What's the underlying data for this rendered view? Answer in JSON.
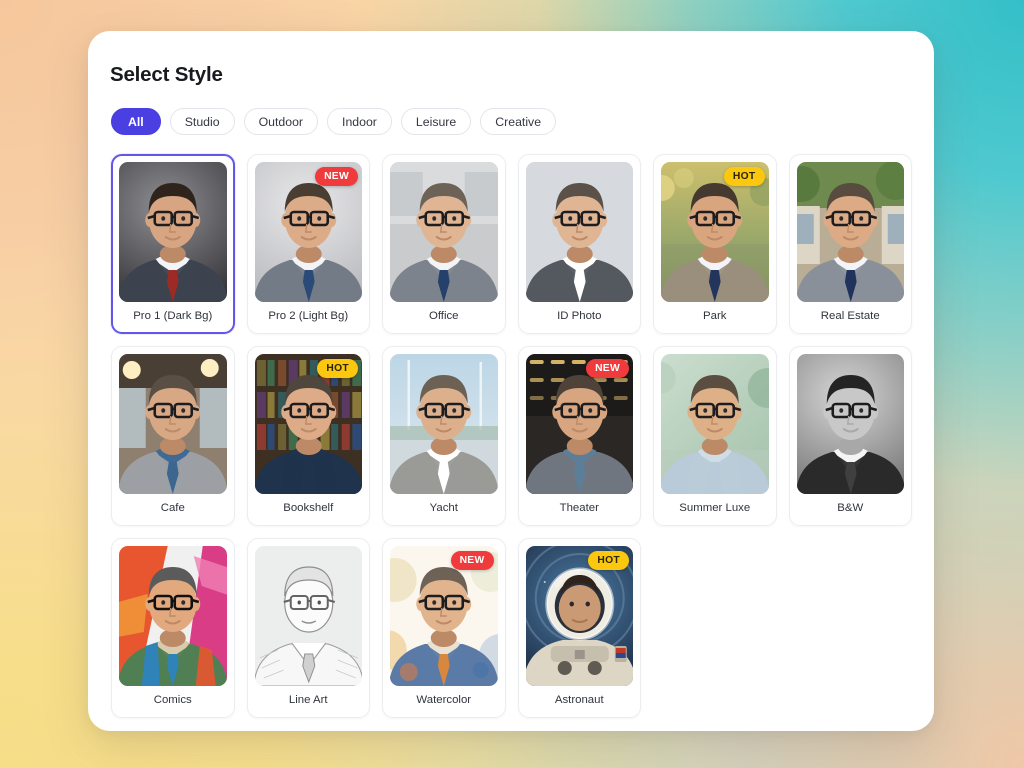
{
  "header": {
    "title": "Select Style"
  },
  "filters": {
    "items": [
      {
        "label": "All",
        "active": true
      },
      {
        "label": "Studio",
        "active": false
      },
      {
        "label": "Outdoor",
        "active": false
      },
      {
        "label": "Indoor",
        "active": false
      },
      {
        "label": "Leisure",
        "active": false
      },
      {
        "label": "Creative",
        "active": false
      }
    ]
  },
  "colors": {
    "accent": "#4a3fe0",
    "selected_border": "#6257e8",
    "badge_new": "#ef3b3b",
    "badge_hot": "#fbc80f",
    "panel_bg": "#ffffff"
  },
  "styles": {
    "cards": [
      {
        "label": "Pro 1 (Dark Bg)",
        "badge": "",
        "selected": true,
        "art": "pro-dark"
      },
      {
        "label": "Pro 2 (Light Bg)",
        "badge": "NEW",
        "selected": false,
        "art": "pro-light"
      },
      {
        "label": "Office",
        "badge": "",
        "selected": false,
        "art": "office"
      },
      {
        "label": "ID Photo",
        "badge": "",
        "selected": false,
        "art": "id-photo"
      },
      {
        "label": "Park",
        "badge": "HOT",
        "selected": false,
        "art": "park"
      },
      {
        "label": "Real Estate",
        "badge": "",
        "selected": false,
        "art": "real-estate"
      },
      {
        "label": "Cafe",
        "badge": "",
        "selected": false,
        "art": "cafe"
      },
      {
        "label": "Bookshelf",
        "badge": "HOT",
        "selected": false,
        "art": "bookshelf"
      },
      {
        "label": "Yacht",
        "badge": "",
        "selected": false,
        "art": "yacht"
      },
      {
        "label": "Theater",
        "badge": "NEW",
        "selected": false,
        "art": "theater"
      },
      {
        "label": "Summer Luxe",
        "badge": "",
        "selected": false,
        "art": "summer-luxe"
      },
      {
        "label": "B&W",
        "badge": "",
        "selected": false,
        "art": "bw"
      },
      {
        "label": "Comics",
        "badge": "",
        "selected": false,
        "art": "comics"
      },
      {
        "label": "Line Art",
        "badge": "",
        "selected": false,
        "art": "line-art"
      },
      {
        "label": "Watercolor",
        "badge": "NEW",
        "selected": false,
        "art": "watercolor"
      },
      {
        "label": "Astronaut",
        "badge": "HOT",
        "selected": false,
        "art": "astronaut"
      }
    ]
  }
}
